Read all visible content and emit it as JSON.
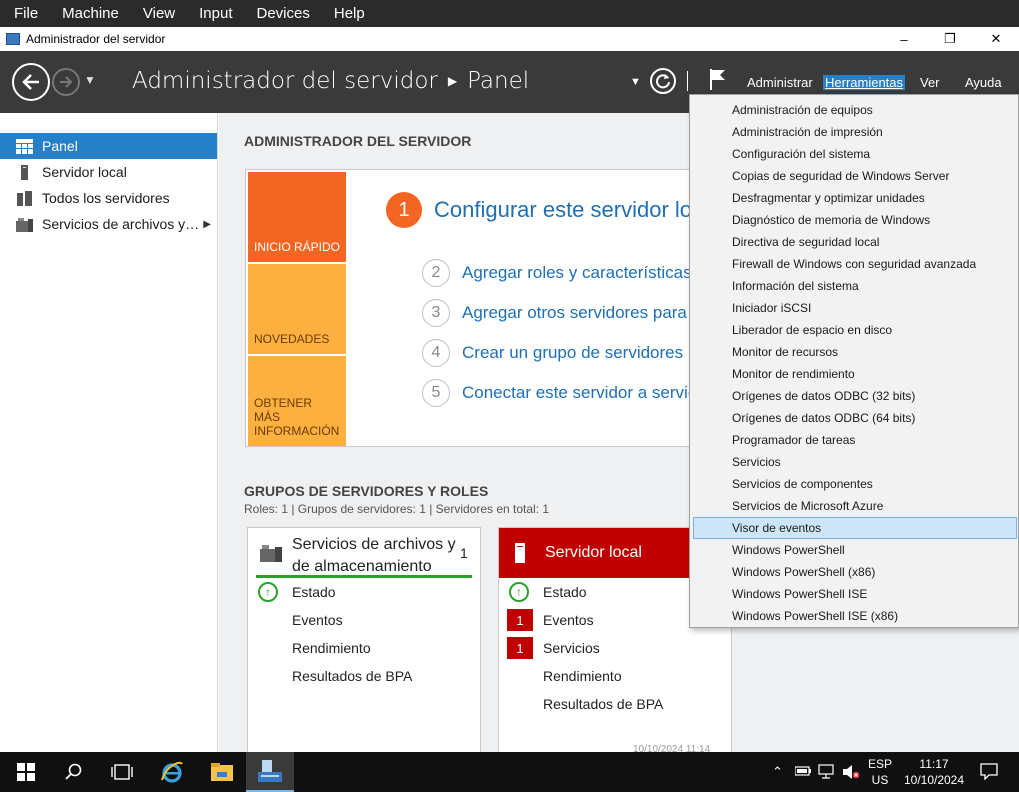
{
  "vbox_menu": [
    "File",
    "Machine",
    "View",
    "Input",
    "Devices",
    "Help"
  ],
  "window": {
    "title": "Administrador del servidor",
    "minimize": "–",
    "maximize": "❐",
    "close": "✕"
  },
  "header": {
    "app": "Administrador del servidor",
    "page": "Panel",
    "menus": {
      "administrar": "Administrar",
      "herramientas": "Herramientas",
      "ver": "Ver",
      "ayuda": "Ayuda"
    }
  },
  "sidebar": {
    "items": [
      {
        "label": "Panel",
        "icon": "dashboard-icon"
      },
      {
        "label": "Servidor local",
        "icon": "server-icon"
      },
      {
        "label": "Todos los servidores",
        "icon": "servers-icon"
      },
      {
        "label": "Servicios de archivos y…",
        "icon": "file-services-icon"
      }
    ]
  },
  "welcome": {
    "title": "ADMINISTRADOR DEL SERVIDOR",
    "tiles": {
      "quick": "INICIO RÁPIDO",
      "news": "NOVEDADES",
      "more": "OBTENER MÁS INFORMACIÓN"
    },
    "steps": [
      {
        "num": "1",
        "label": "Configurar este servidor local"
      },
      {
        "num": "2",
        "label": "Agregar roles y características"
      },
      {
        "num": "3",
        "label": "Agregar otros servidores para administrar"
      },
      {
        "num": "4",
        "label": "Crear un grupo de servidores"
      },
      {
        "num": "5",
        "label": "Conectar este servidor a servicios en la nube"
      }
    ]
  },
  "groups": {
    "title": "GRUPOS DE SERVIDORES Y ROLES",
    "stats": "Roles: 1   |   Grupos de servidores: 1   |   Servidores en total: 1",
    "file_card": {
      "title_line1": "Servicios de archivos y",
      "title_line2": "de almacenamiento",
      "count": "1",
      "rows": {
        "estado": "Estado",
        "eventos": "Eventos",
        "rendimiento": "Rendimiento",
        "bpa": "Resultados de BPA"
      }
    },
    "local_card": {
      "title": "Servidor local",
      "rows": {
        "estado": "Estado",
        "eventos": "Eventos",
        "eventos_badge": "1",
        "servicios": "Servicios",
        "servicios_badge": "1",
        "rendimiento": "Rendimiento",
        "bpa": "Resultados de BPA"
      },
      "timestamp": "10/10/2024 11:14"
    }
  },
  "tools_menu": [
    "Administración de equipos",
    "Administración de impresión",
    "Configuración del sistema",
    "Copias de seguridad de Windows Server",
    "Desfragmentar y optimizar unidades",
    "Diagnóstico de memoria de Windows",
    "Directiva de seguridad local",
    "Firewall de Windows con seguridad avanzada",
    "Información del sistema",
    "Iniciador iSCSI",
    "Liberador de espacio en disco",
    "Monitor de recursos",
    "Monitor de rendimiento",
    "Orígenes de datos ODBC (32 bits)",
    "Orígenes de datos ODBC (64 bits)",
    "Programador de tareas",
    "Servicios",
    "Servicios de componentes",
    "Servicios de Microsoft Azure",
    "Visor de eventos",
    "Windows PowerShell",
    "Windows PowerShell (x86)",
    "Windows PowerShell ISE",
    "Windows PowerShell ISE (x86)"
  ],
  "tools_menu_highlighted": "Visor de eventos",
  "taskbar": {
    "lang_top": "ESP",
    "lang_bottom": "US",
    "time": "11:17",
    "date": "10/10/2024"
  },
  "colors": {
    "accent": "#2680c9",
    "orange": "#f26522",
    "tile_light": "#fbb040",
    "local_red": "#c00000",
    "header_bg": "#3a3a3a"
  }
}
